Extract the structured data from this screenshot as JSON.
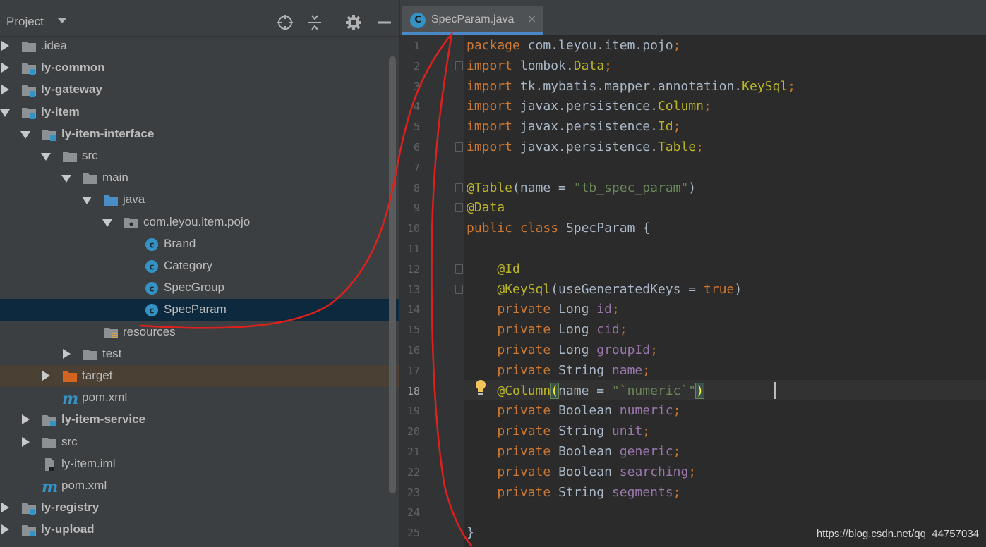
{
  "project_panel": {
    "title": "Project",
    "tree": [
      {
        "label": ".idea",
        "depth": 0,
        "state": "collapsed",
        "icon": "folder-icon",
        "bold": false
      },
      {
        "label": "ly-common",
        "depth": 0,
        "state": "collapsed",
        "icon": "module-icon",
        "bold": true
      },
      {
        "label": "ly-gateway",
        "depth": 0,
        "state": "collapsed",
        "icon": "module-icon",
        "bold": true
      },
      {
        "label": "ly-item",
        "depth": 0,
        "state": "expanded",
        "icon": "module-icon",
        "bold": true
      },
      {
        "label": "ly-item-interface",
        "depth": 1,
        "state": "expanded",
        "icon": "module-icon",
        "bold": true
      },
      {
        "label": "src",
        "depth": 2,
        "state": "expanded",
        "icon": "folder-icon",
        "bold": false
      },
      {
        "label": "main",
        "depth": 3,
        "state": "expanded",
        "icon": "folder-icon",
        "bold": false
      },
      {
        "label": "java",
        "depth": 4,
        "state": "expanded",
        "icon": "source-folder-icon",
        "bold": false
      },
      {
        "label": "com.leyou.item.pojo",
        "depth": 5,
        "state": "expanded",
        "icon": "package-icon",
        "bold": false
      },
      {
        "label": "Brand",
        "depth": 6,
        "state": "leaf",
        "icon": "java-class-icon",
        "bold": false
      },
      {
        "label": "Category",
        "depth": 6,
        "state": "leaf",
        "icon": "java-class-icon",
        "bold": false
      },
      {
        "label": "SpecGroup",
        "depth": 6,
        "state": "leaf",
        "icon": "java-class-icon",
        "bold": false
      },
      {
        "label": "SpecParam",
        "depth": 6,
        "state": "leaf",
        "icon": "java-class-icon",
        "bold": false,
        "selected": true
      },
      {
        "label": "resources",
        "depth": 4,
        "state": "leaf",
        "icon": "resources-folder-icon",
        "bold": false
      },
      {
        "label": "test",
        "depth": 3,
        "state": "collapsed",
        "icon": "folder-icon",
        "bold": false
      },
      {
        "label": "target",
        "depth": 2,
        "state": "collapsed",
        "icon": "excluded-folder-icon",
        "bold": false,
        "excluded": true
      },
      {
        "label": "pom.xml",
        "depth": 2,
        "state": "leaf",
        "icon": "maven-icon",
        "bold": false
      },
      {
        "label": "ly-item-service",
        "depth": 1,
        "state": "collapsed",
        "icon": "module-icon",
        "bold": true
      },
      {
        "label": "src",
        "depth": 1,
        "state": "collapsed",
        "icon": "folder-icon",
        "bold": false
      },
      {
        "label": "ly-item.iml",
        "depth": 1,
        "state": "leaf",
        "icon": "iml-file-icon",
        "bold": false
      },
      {
        "label": "pom.xml",
        "depth": 1,
        "state": "leaf",
        "icon": "maven-icon",
        "bold": false
      },
      {
        "label": "ly-registry",
        "depth": 0,
        "state": "collapsed",
        "icon": "module-icon",
        "bold": true
      },
      {
        "label": "ly-upload",
        "depth": 0,
        "state": "collapsed",
        "icon": "module-icon",
        "bold": true
      }
    ]
  },
  "editor": {
    "tab": {
      "icon_letter": "C",
      "label": "SpecParam.java",
      "close": "×"
    },
    "current_line": 18,
    "lines": [
      [
        [
          "kw",
          "package "
        ],
        [
          "txt",
          "com.leyou.item.pojo"
        ],
        [
          "kw",
          ";"
        ]
      ],
      [
        [
          "kw",
          "import "
        ],
        [
          "txt",
          "lombok."
        ],
        [
          "cls",
          "Data"
        ],
        [
          "kw",
          ";"
        ]
      ],
      [
        [
          "kw",
          "import "
        ],
        [
          "txt",
          "tk.mybatis.mapper.annotation."
        ],
        [
          "cls",
          "KeySql"
        ],
        [
          "kw",
          ";"
        ]
      ],
      [
        [
          "kw",
          "import "
        ],
        [
          "txt",
          "javax.persistence."
        ],
        [
          "cls",
          "Column"
        ],
        [
          "kw",
          ";"
        ]
      ],
      [
        [
          "kw",
          "import "
        ],
        [
          "txt",
          "javax.persistence."
        ],
        [
          "cls",
          "Id"
        ],
        [
          "kw",
          ";"
        ]
      ],
      [
        [
          "kw",
          "import "
        ],
        [
          "txt",
          "javax.persistence."
        ],
        [
          "cls",
          "Table"
        ],
        [
          "kw",
          ";"
        ]
      ],
      [],
      [
        [
          "ann",
          "@Table"
        ],
        [
          "txt",
          "(name = "
        ],
        [
          "str",
          "\"tb_spec_param\""
        ],
        [
          "txt",
          ")"
        ]
      ],
      [
        [
          "ann",
          "@Data"
        ]
      ],
      [
        [
          "kw",
          "public class "
        ],
        [
          "txt",
          "SpecParam {"
        ]
      ],
      [],
      [
        [
          "txt",
          "    "
        ],
        [
          "ann",
          "@Id"
        ]
      ],
      [
        [
          "txt",
          "    "
        ],
        [
          "ann",
          "@KeySql"
        ],
        [
          "txt",
          "(useGeneratedKeys = "
        ],
        [
          "kw",
          "true"
        ],
        [
          "txt",
          ")"
        ]
      ],
      [
        [
          "txt",
          "    "
        ],
        [
          "kw",
          "private "
        ],
        [
          "txt",
          "Long "
        ],
        [
          "fld",
          "id"
        ],
        [
          "kw",
          ";"
        ]
      ],
      [
        [
          "txt",
          "    "
        ],
        [
          "kw",
          "private "
        ],
        [
          "txt",
          "Long "
        ],
        [
          "fld",
          "cid"
        ],
        [
          "kw",
          ";"
        ]
      ],
      [
        [
          "txt",
          "    "
        ],
        [
          "kw",
          "private "
        ],
        [
          "txt",
          "Long "
        ],
        [
          "fld",
          "groupId"
        ],
        [
          "kw",
          ";"
        ]
      ],
      [
        [
          "txt",
          "    "
        ],
        [
          "kw",
          "private "
        ],
        [
          "txt",
          "String "
        ],
        [
          "fld",
          "name"
        ],
        [
          "kw",
          ";"
        ]
      ],
      [
        [
          "txt",
          "    "
        ],
        [
          "ann",
          "@Column"
        ],
        [
          "cur-paren",
          "("
        ],
        [
          "txt",
          "name = "
        ],
        [
          "str",
          "\"`numeric`\""
        ],
        [
          "cur-paren",
          ")"
        ]
      ],
      [
        [
          "txt",
          "    "
        ],
        [
          "kw",
          "private "
        ],
        [
          "txt",
          "Boolean "
        ],
        [
          "fld",
          "numeric"
        ],
        [
          "kw",
          ";"
        ]
      ],
      [
        [
          "txt",
          "    "
        ],
        [
          "kw",
          "private "
        ],
        [
          "txt",
          "String "
        ],
        [
          "fld",
          "unit"
        ],
        [
          "kw",
          ";"
        ]
      ],
      [
        [
          "txt",
          "    "
        ],
        [
          "kw",
          "private "
        ],
        [
          "txt",
          "Boolean "
        ],
        [
          "fld",
          "generic"
        ],
        [
          "kw",
          ";"
        ]
      ],
      [
        [
          "txt",
          "    "
        ],
        [
          "kw",
          "private "
        ],
        [
          "txt",
          "Boolean "
        ],
        [
          "fld",
          "searching"
        ],
        [
          "kw",
          ";"
        ]
      ],
      [
        [
          "txt",
          "    "
        ],
        [
          "kw",
          "private "
        ],
        [
          "txt",
          "String "
        ],
        [
          "fld",
          "segments"
        ],
        [
          "kw",
          ";"
        ]
      ],
      [],
      [
        [
          "txt",
          "}"
        ]
      ]
    ],
    "fold_markers": [
      2,
      6,
      8,
      9,
      12,
      13
    ]
  },
  "watermark": "https://blog.csdn.net/qq_44757034",
  "colors": {
    "keyword": "#cc7832",
    "annotation": "#bbb529",
    "string": "#6a8759",
    "field": "#9876aa",
    "text": "#a9b7c6",
    "selection": "#0d293e",
    "annotation_stroke": "#e0201c"
  }
}
